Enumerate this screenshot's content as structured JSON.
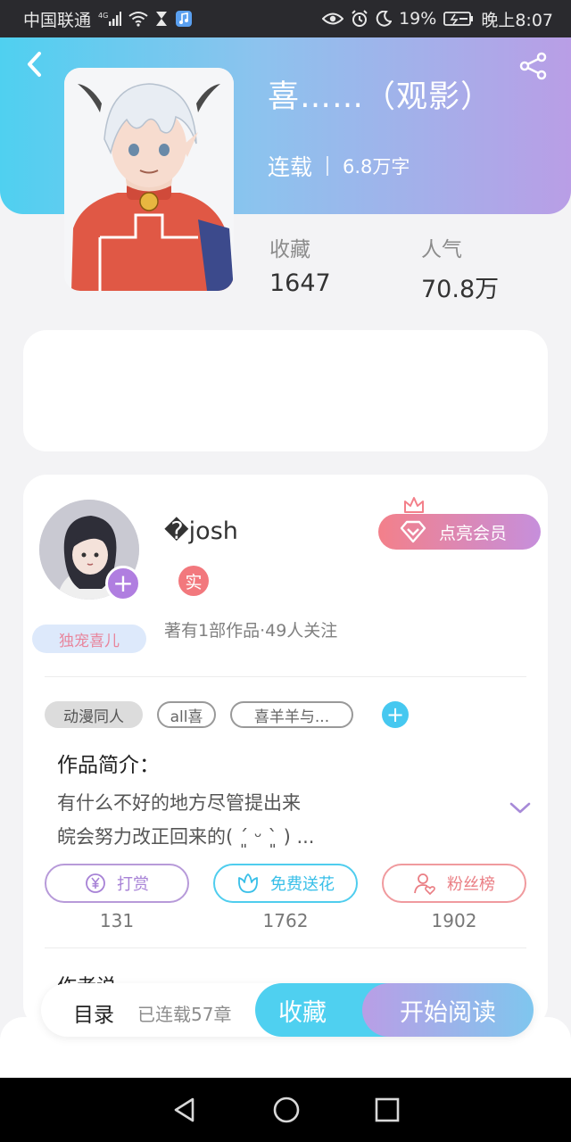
{
  "status_bar": {
    "carrier": "中国联通",
    "network": "4G",
    "battery": "19%",
    "time": "晚上8:07"
  },
  "book": {
    "title": "喜……（观影）",
    "status": "连载",
    "word_count": "6.8万字",
    "favorites_label": "收藏",
    "favorites_value": "1647",
    "popularity_label": "人气",
    "popularity_value": "70.8万"
  },
  "author": {
    "name": "�josh",
    "badge": "独宠喜儿",
    "verified_label": "实",
    "stats": "著有1部作品·49人关注",
    "vip_button": "点亮会员"
  },
  "tags": [
    "动漫同人",
    "all喜",
    "喜羊羊与..."
  ],
  "intro": {
    "label": "作品简介：",
    "line1": "有什么不好的地方尽管提出来",
    "line2": "皖会努力改正回来的( ´͈ ᵕ `͈ ) ..."
  },
  "actions": [
    {
      "label": "打赏",
      "count": "131"
    },
    {
      "label": "免费送花",
      "count": "1762"
    },
    {
      "label": "粉丝榜",
      "count": "1902"
    }
  ],
  "section_peek": "作者说",
  "bottom_bar": {
    "toc": "目录",
    "chapters": "已连载57章",
    "favorite": "收藏",
    "read": "开始阅读"
  },
  "colors": {
    "cyan": "#4fd0f0",
    "purple": "#b99ee6",
    "pink": "#f2787d",
    "vip_gradient_start": "#f3808a",
    "vip_gradient_end": "#c68fdc"
  }
}
